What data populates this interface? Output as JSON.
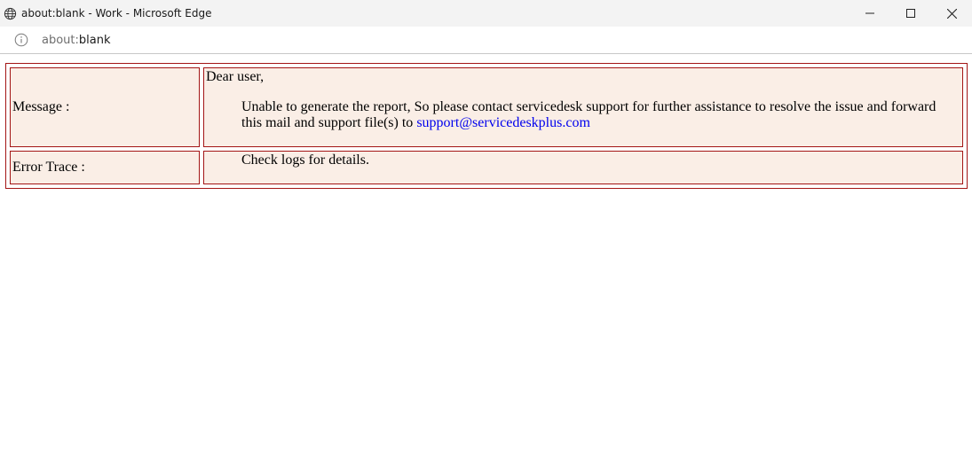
{
  "window": {
    "title": "about:blank - Work - Microsoft Edge",
    "icon": "globe-icon",
    "controls": [
      "minimize-icon",
      "maximize-icon",
      "close-icon"
    ]
  },
  "address": {
    "scheme": "about:",
    "rest": "blank",
    "icon": "info-icon"
  },
  "report": {
    "message_label": "Message :",
    "greeting": "Dear user,",
    "message_text": "Unable to generate the report, So please contact servicedesk support for further assistance to resolve the issue and forward this mail and support file(s) to ",
    "support_email": "support@servicedeskplus.com",
    "error_label": "Error Trace :",
    "error_text": "Check logs for details."
  },
  "colors": {
    "cell_bg": "#faeee6",
    "border": "#a31515",
    "link": "#0000ee"
  }
}
